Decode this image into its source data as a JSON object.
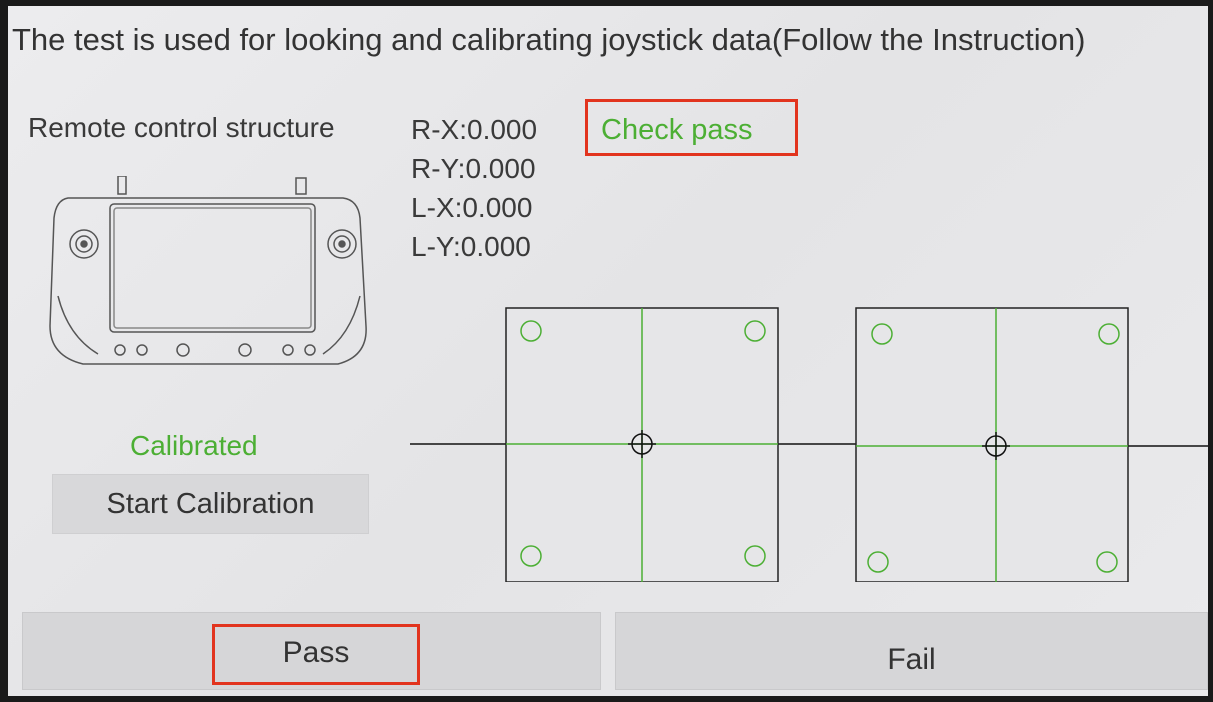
{
  "header": {
    "title": "The test is used for looking and calibrating joystick data(Follow the Instruction)"
  },
  "structure": {
    "label": "Remote control structure"
  },
  "coords": {
    "rx": "R-X:0.000",
    "ry": "R-Y:0.000",
    "lx": "L-X:0.000",
    "ly": "L-Y:0.000"
  },
  "status": {
    "check": "Check pass",
    "calibrated": "Calibrated"
  },
  "buttons": {
    "start_calibration": "Start Calibration",
    "pass": "Pass",
    "fail": "Fail"
  },
  "colors": {
    "accent_green": "#4caf34",
    "highlight_red": "#e2341e"
  }
}
